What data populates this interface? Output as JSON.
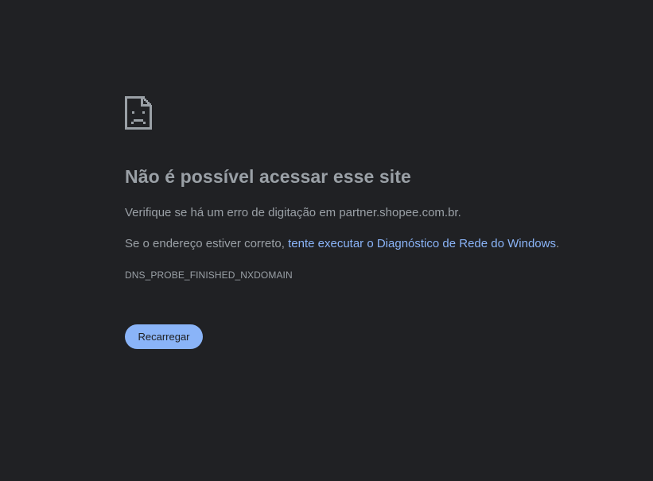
{
  "icon": "sad-document-icon",
  "colors": {
    "background": "#202124",
    "text": "#9aa0a6",
    "link": "#8ab4f8",
    "button_bg": "#8ab4f8",
    "button_text": "#202124"
  },
  "error": {
    "title": "Não é possível acessar esse site",
    "typo_message": "Verifique se há um erro de digitação em partner.shopee.com.br.",
    "suggestion_prefix": "Se o endereço estiver correto, ",
    "suggestion_link": "tente executar o Diagnóstico de Rede do Windows",
    "suggestion_suffix": ".",
    "code": "DNS_PROBE_FINISHED_NXDOMAIN"
  },
  "reload_button": {
    "label": "Recarregar"
  }
}
